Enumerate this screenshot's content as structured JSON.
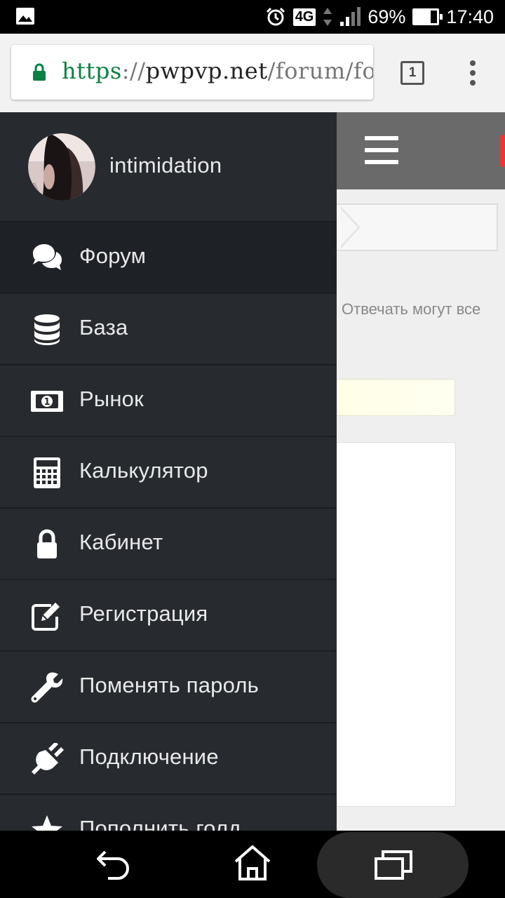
{
  "status_bar": {
    "network": "4G",
    "battery_percent": "69%",
    "battery_level": 0.69,
    "time": "17:40",
    "icons": [
      "gallery-icon",
      "alarm-icon",
      "network-arrows-icon",
      "signal-icon",
      "battery-icon"
    ]
  },
  "browser": {
    "url_scheme": "https",
    "url_separator": "://",
    "url_host": "pwpvp.net",
    "url_path": "/forum/foru",
    "tab_count": "1",
    "secure_color": "#0b8043"
  },
  "page": {
    "reply_note": "Отвечать могут все"
  },
  "drawer": {
    "username": "intimidation",
    "items": [
      {
        "label": "Форум",
        "icon": "comments-icon",
        "active": true
      },
      {
        "label": "База",
        "icon": "database-icon",
        "active": false
      },
      {
        "label": "Рынок",
        "icon": "money-icon",
        "active": false
      },
      {
        "label": "Калькулятор",
        "icon": "calculator-icon",
        "active": false
      },
      {
        "label": "Кабинет",
        "icon": "lock-icon",
        "active": false
      },
      {
        "label": "Регистрация",
        "icon": "edit-icon",
        "active": false
      },
      {
        "label": "Поменять пароль",
        "icon": "wrench-icon",
        "active": false
      },
      {
        "label": "Подключение",
        "icon": "plug-icon",
        "active": false
      },
      {
        "label": "Пополнить голд",
        "icon": "star-icon",
        "active": false
      }
    ]
  },
  "colors": {
    "drawer_bg": "#272b30",
    "drawer_active": "#1e2125",
    "header_gray": "#6a6a6a",
    "accent_red": "#e53935"
  }
}
